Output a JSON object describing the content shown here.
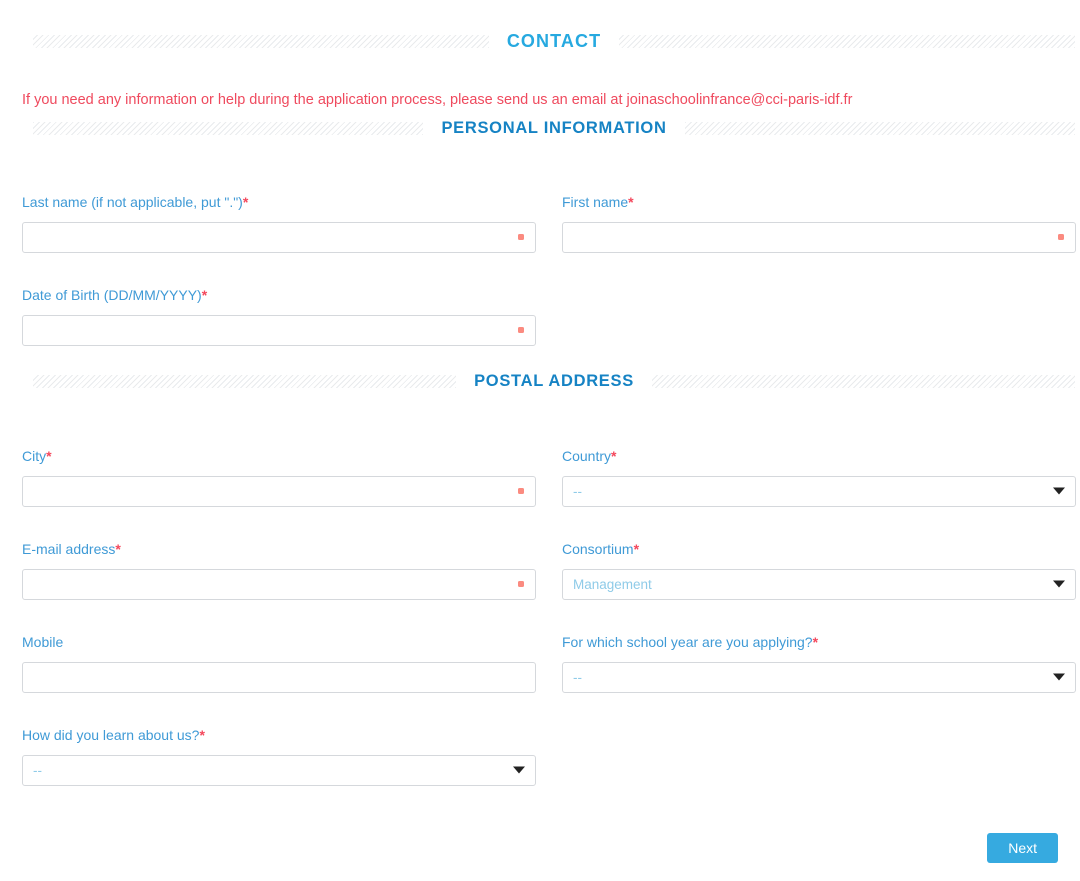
{
  "headers": {
    "contact": "CONTACT",
    "personal_information": "PERSONAL INFORMATION",
    "postal_address": "POSTAL ADDRESS"
  },
  "notice": {
    "text": "If you need any information or help during the application process, please send us an email at joinaschoolinfrance@cci-paris-idf.fr"
  },
  "colors": {
    "contact_title": "#26a9e0",
    "section_title": "#1683c4",
    "label": "#3f9ad6",
    "required_asterisk": "#f4485c",
    "notice": "#ef4a5e",
    "required_dot": "#fb8b80",
    "button": "#36aae0",
    "input_border": "#d5d8dc",
    "select_value": "#8fcbe8"
  },
  "fields": {
    "last_name": {
      "label": "Last name (if not applicable, put \".\")",
      "required_mark": "*",
      "value": "",
      "placeholder": ""
    },
    "first_name": {
      "label": "First name",
      "required_mark": "*",
      "value": "",
      "placeholder": ""
    },
    "date_of_birth": {
      "label": "Date of Birth (DD/MM/YYYY)",
      "required_mark": "*",
      "value": "",
      "placeholder": ""
    },
    "city": {
      "label": "City",
      "required_mark": "*",
      "value": "",
      "placeholder": ""
    },
    "country": {
      "label": "Country",
      "required_mark": "*",
      "value": "--"
    },
    "email": {
      "label": "E-mail address",
      "required_mark": "*",
      "value": "",
      "placeholder": ""
    },
    "consortium": {
      "label": "Consortium",
      "required_mark": "*",
      "value": "Management"
    },
    "mobile": {
      "label": "Mobile",
      "required_mark": "",
      "value": "",
      "placeholder": ""
    },
    "school_year": {
      "label": "For which school year are you applying?",
      "required_mark": "*",
      "value": "--"
    },
    "learn_about_us": {
      "label": "How did you learn about us?",
      "required_mark": "*",
      "value": "--"
    }
  },
  "footer": {
    "next_label": "Next"
  }
}
